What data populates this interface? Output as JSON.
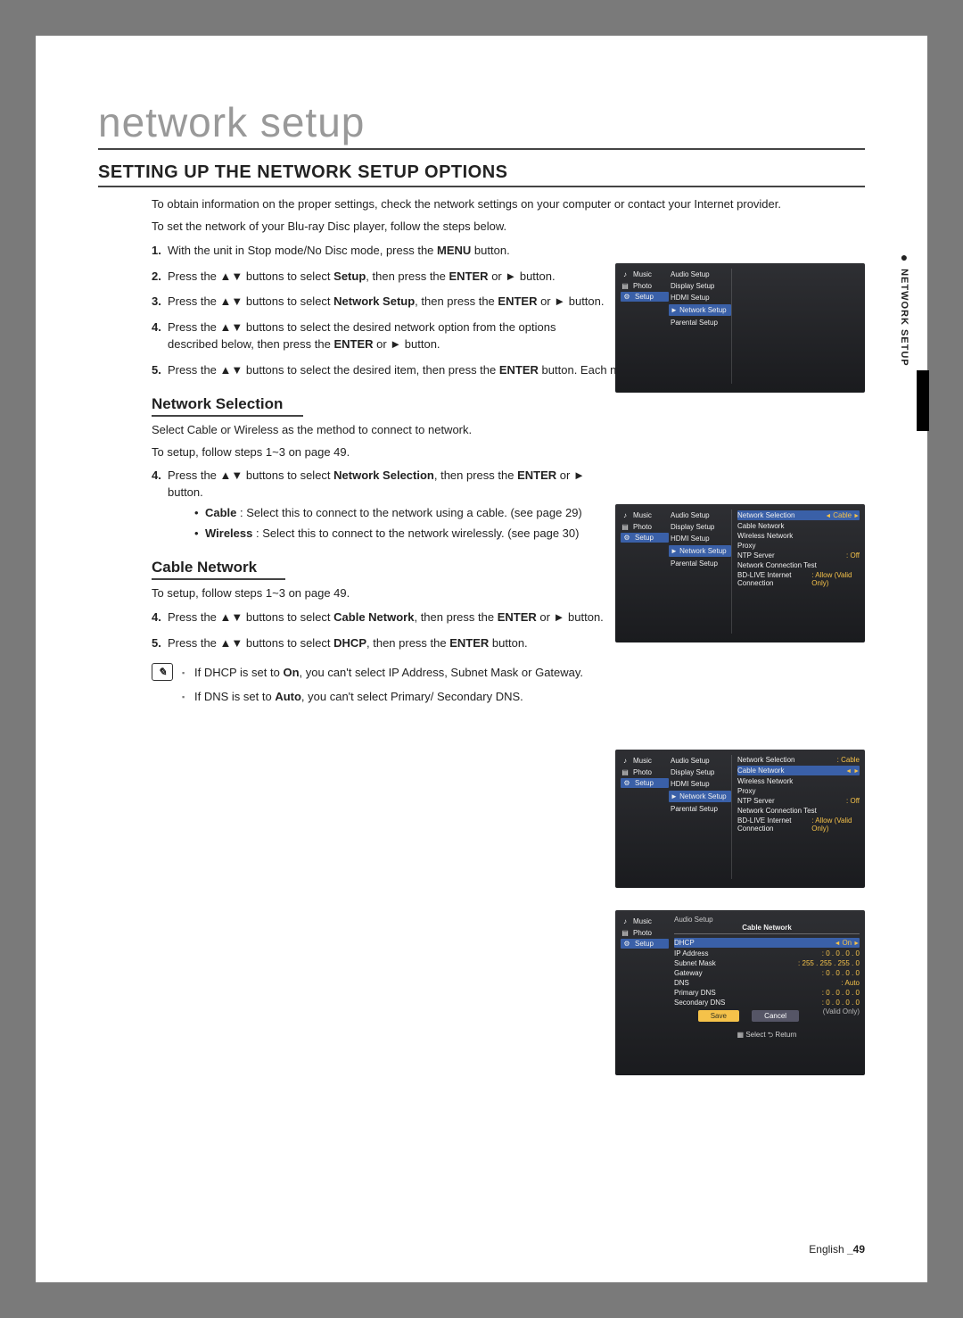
{
  "chapter": "network setup",
  "section_title": "SETTING UP THE NETWORK SETUP OPTIONS",
  "intro1": "To obtain information on the proper settings, check the network settings on your computer or contact your Internet provider.",
  "intro2": "To set the network of your Blu-ray Disc player, follow the steps below.",
  "steps_main": [
    {
      "n": "1.",
      "pre": "With the unit in Stop mode/No Disc mode, press the ",
      "bold": "MENU",
      "post": " button."
    },
    {
      "n": "2.",
      "pre": "Press the ▲▼ buttons to select ",
      "bold": "Setup",
      "post": ", then press the ",
      "bold2": "ENTER",
      "post2": " or ► button."
    },
    {
      "n": "3.",
      "pre": "Press the ▲▼ buttons to select ",
      "bold": "Network Setup",
      "post": ", then press the ",
      "bold2": "ENTER",
      "post2": " or ► button."
    },
    {
      "n": "4.",
      "pre": "Press the ▲▼ buttons to select the desired network option from the options described below, then press the ",
      "bold": "ENTER",
      "post": " or ► button."
    },
    {
      "n": "5.",
      "pre": "Press the ▲▼ buttons to select the desired item, then press the ",
      "bold": "ENTER",
      "post": " button. Each network option is described in detail below."
    }
  ],
  "network_selection": {
    "title": "Network Selection",
    "p1": "Select Cable or Wireless as the method to connect to network.",
    "p2": "To setup, follow steps 1~3 on page 49.",
    "step4_pre": "Press the ▲▼ buttons to select ",
    "step4_bold": "Network Selection",
    "step4_post": ", then press the ",
    "step4_bold2": "ENTER",
    "step4_post2": " or ► button.",
    "bul1_bold": "Cable",
    "bul1_text": " : Select this to connect to the network using a cable. (see page 29)",
    "bul2_bold": "Wireless",
    "bul2_text": " : Select this to connect to the network wirelessly. (see page 30)"
  },
  "cable_network": {
    "title": "Cable Network",
    "p1": "To setup, follow steps 1~3 on page 49.",
    "step4_pre": "Press the ▲▼ buttons to select ",
    "step4_bold": "Cable Network",
    "step4_post": ", then press the ",
    "step4_bold2": "ENTER",
    "step4_post2": " or ► button.",
    "step5_pre": "Press the ▲▼ buttons to select ",
    "step5_bold": "DHCP",
    "step5_post": ", then press the ",
    "step5_bold2": "ENTER",
    "step5_post2": " button.",
    "note1_pre": "If DHCP is set to ",
    "note1_bold": "On",
    "note1_post": ", you can't select IP Address, Subnet Mask or Gateway.",
    "note2_pre": "If DNS is set to ",
    "note2_bold": "Auto",
    "note2_post": ", you can't select Primary/ Secondary DNS."
  },
  "side_tab": "NETWORK SETUP",
  "footer_lang": "English ",
  "footer_page": "_49",
  "shot_common": {
    "left_items": [
      "Music",
      "Photo",
      "Setup"
    ],
    "mid_items": [
      "Audio Setup",
      "Display Setup",
      "HDMI Setup",
      "Network Setup",
      "Parental Setup"
    ]
  },
  "shot2_right": {
    "items": [
      {
        "k": "Network Selection",
        "v": "Cable",
        "sel": true
      },
      {
        "k": "Cable Network"
      },
      {
        "k": "Wireless Network"
      },
      {
        "k": "Proxy"
      },
      {
        "k": "NTP Server",
        "v": "Off"
      },
      {
        "k": "Network Connection Test"
      },
      {
        "k": "BD-LIVE Internet Connection",
        "v": "Allow (Valid Only)"
      }
    ]
  },
  "shot3_right": {
    "items": [
      {
        "k": "Network Selection",
        "v": "Cable"
      },
      {
        "k": "Cable Network",
        "sel": true
      },
      {
        "k": "Wireless Network"
      },
      {
        "k": "Proxy"
      },
      {
        "k": "NTP Server",
        "v": "Off"
      },
      {
        "k": "Network Connection Test"
      },
      {
        "k": "BD-LIVE Internet Connection",
        "v": "Allow (Valid Only)"
      }
    ]
  },
  "shot4": {
    "title": "Cable Network",
    "rows": [
      {
        "k": "DHCP",
        "v": "On",
        "sel": true
      },
      {
        "k": "IP Address",
        "v": "0 . 0 . 0 . 0"
      },
      {
        "k": "Subnet Mask",
        "v": "255 . 255 . 255 . 0"
      },
      {
        "k": "Gateway",
        "v": "0 . 0 . 0 . 0"
      },
      {
        "k": "DNS",
        "v": "Auto"
      },
      {
        "k": "Primary DNS",
        "v": "0 . 0 . 0 . 0"
      },
      {
        "k": "Secondary DNS",
        "v": "0 . 0 . 0 . 0"
      }
    ],
    "ok": "Save",
    "cancel": "Cancel",
    "valid": "(Valid Only)",
    "bottom": "▦ Select     ⮌ Return"
  }
}
